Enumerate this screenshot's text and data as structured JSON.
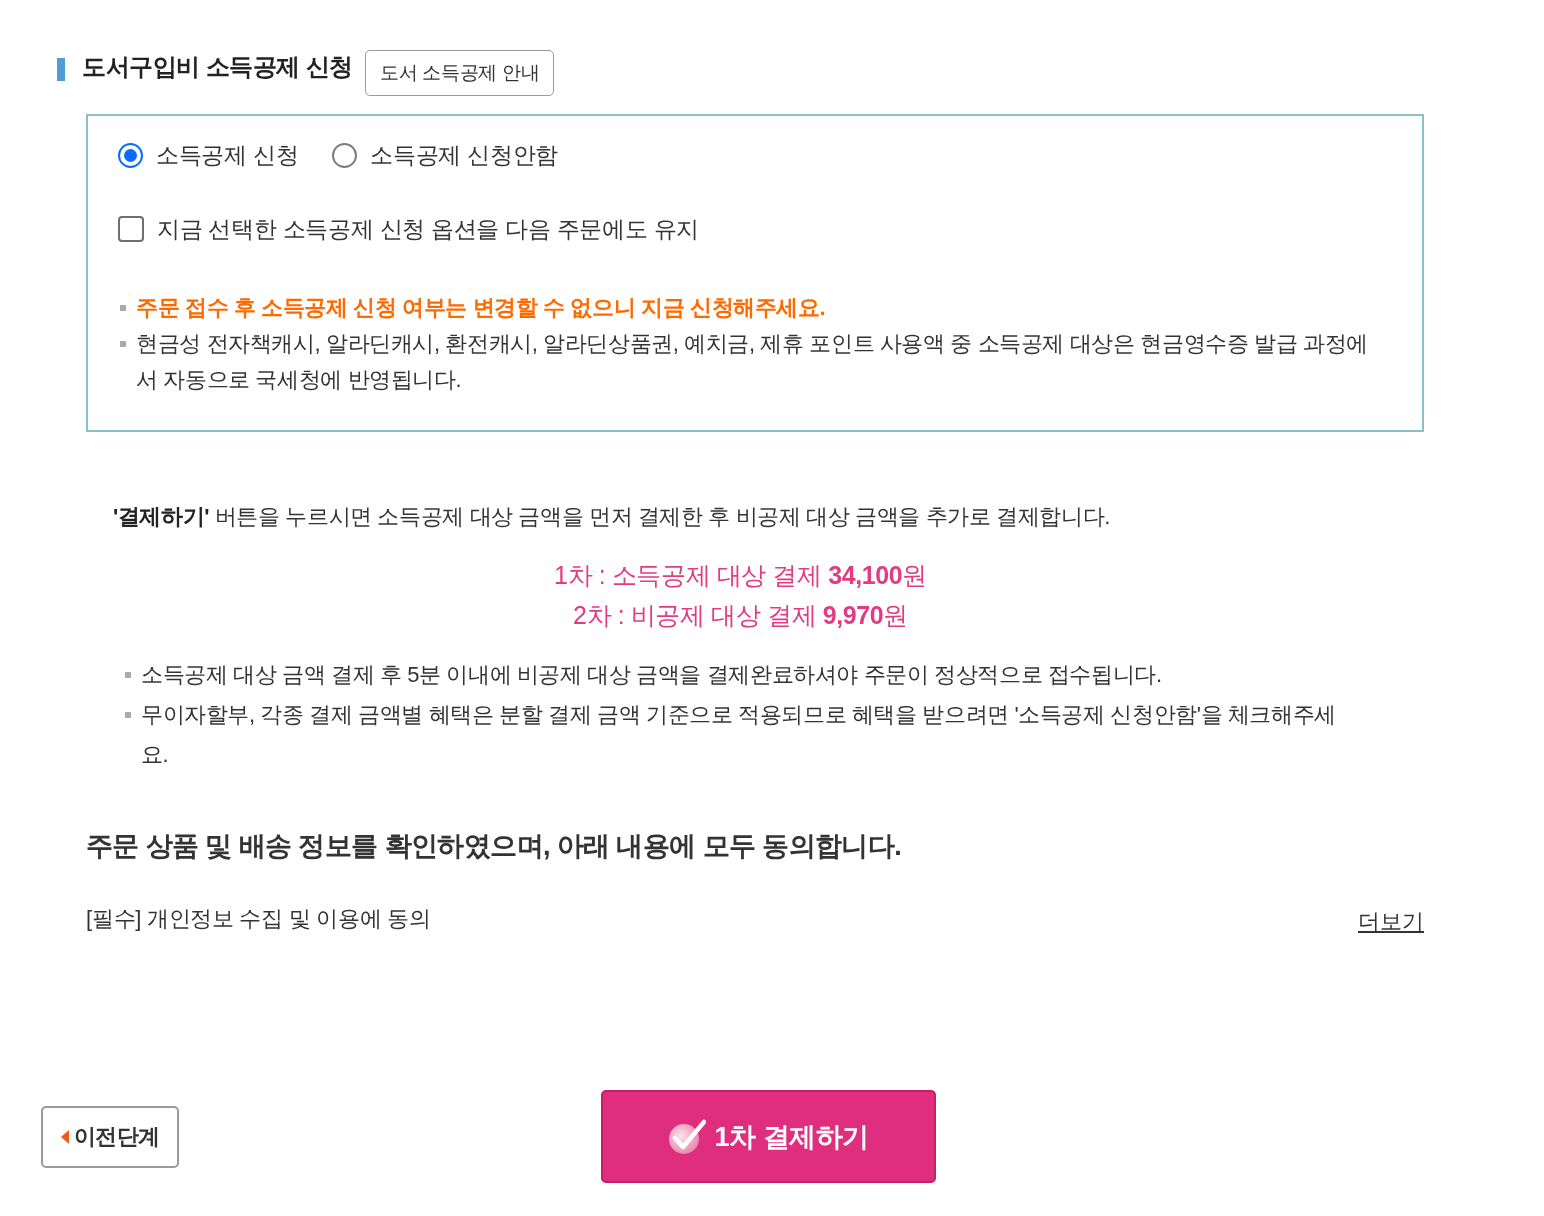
{
  "section": {
    "title": "도서구입비 소득공제 신청",
    "guide_button": "도서 소득공제 안내"
  },
  "options": {
    "radios": [
      {
        "label": "소득공제 신청",
        "selected": true
      },
      {
        "label": "소득공제 신청안함",
        "selected": false
      }
    ],
    "keep_option": {
      "label": "지금 선택한 소득공제 신청 옵션을 다음 주문에도 유지",
      "checked": false
    },
    "notes": [
      {
        "kind": "warning",
        "text": "주문 접수 후 소득공제 신청 여부는 변경할 수 없으니 지금 신청해주세요."
      },
      {
        "kind": "plain",
        "text": "현금성 전자책캐시, 알라딘캐시, 환전캐시, 알라딘상품권, 예치금, 제휴 포인트 사용액 중 소득공제 대상은 현금영수증 발급 과정에서 자동으로 국세청에 반영됩니다."
      }
    ]
  },
  "payment_info": {
    "intro": "**'결제하기'** 버튼을 누르시면 소득공제 대상 금액을 먼저 결제한 후 비공제 대상 금액을 추가로 결제합니다.",
    "steps": [
      "1차 : 소득공제 대상 결제 **34,100**원",
      "2차 : 비공제 대상 결제 **9,970**원"
    ],
    "notes": [
      "소득공제 대상 금액 결제 후 5분 이내에 비공제 대상 금액을 결제완료하셔야 주문이 정상적으로 접수됩니다.",
      "무이자할부, 각종 결제 금액별 혜택은 분할 결제 금액 기준으로 적용되므로 혜택을 받으려면 '소득공제 신청안함'을 체크해주세요."
    ]
  },
  "agreement": {
    "heading": "주문 상품 및 배송 정보를 확인하였으며, 아래 내용에 모두 동의합니다.",
    "items": [
      {
        "label": "[필수] 개인정보 수집 및 이용에 동의",
        "link": "더보기"
      }
    ]
  },
  "buttons": {
    "back": "이전단계",
    "pay": "1차 결제하기"
  }
}
